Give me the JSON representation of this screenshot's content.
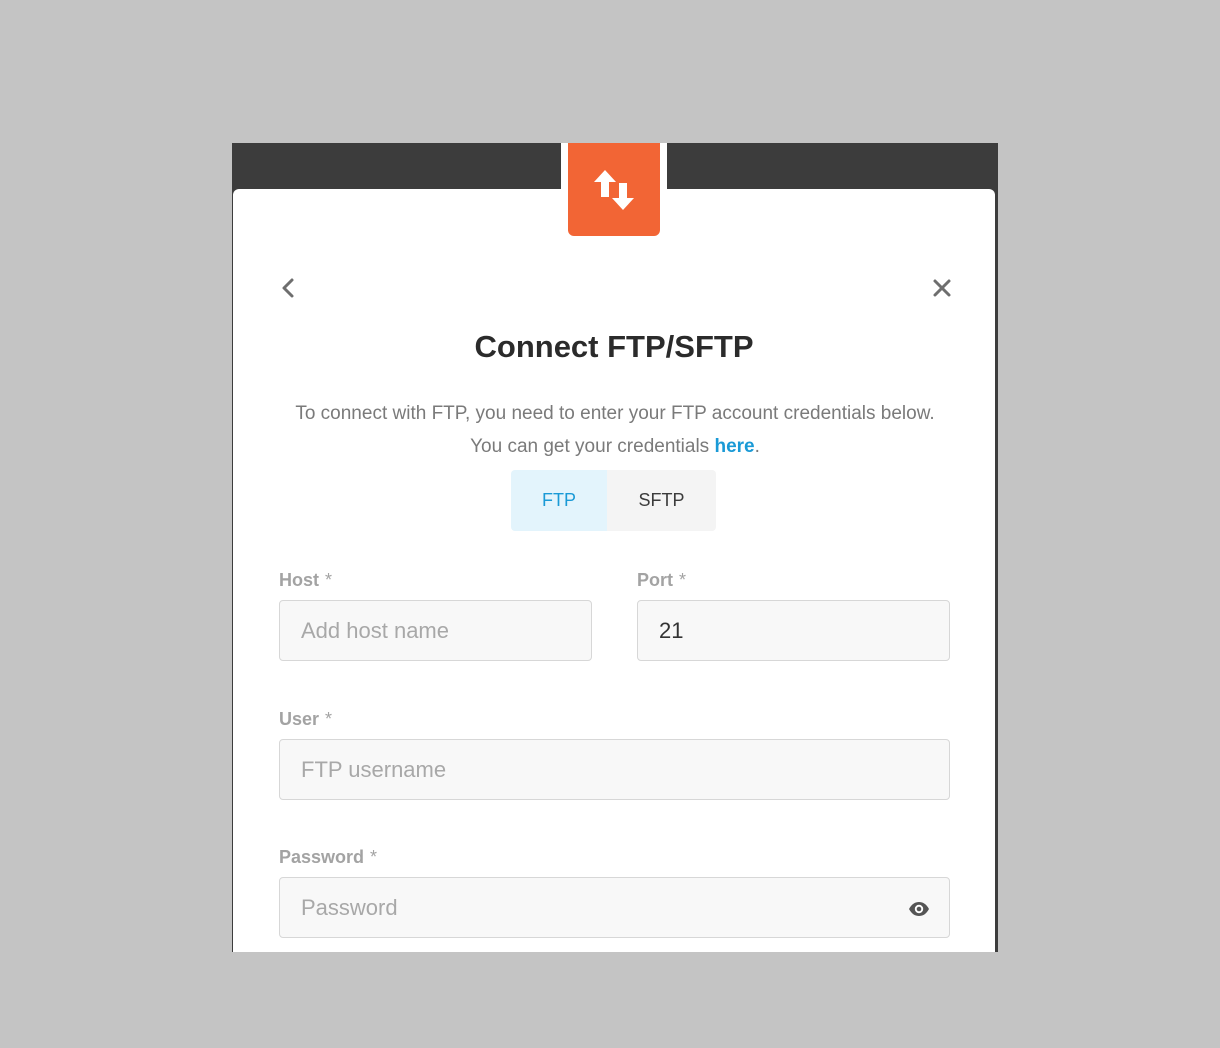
{
  "dialog": {
    "title": "Connect FTP/SFTP",
    "description": "To connect with FTP, you need to enter your FTP account credentials below. You can get your credentials ",
    "link_text": "here",
    "description_end": "."
  },
  "tabs": [
    {
      "label": "FTP",
      "active": true
    },
    {
      "label": "SFTP",
      "active": false
    }
  ],
  "fields": {
    "host": {
      "label": "Host",
      "required": "*",
      "placeholder": "Add host name",
      "value": ""
    },
    "port": {
      "label": "Port",
      "required": "*",
      "placeholder": "",
      "value": "21"
    },
    "user": {
      "label": "User",
      "required": "*",
      "placeholder": "FTP username",
      "value": ""
    },
    "password": {
      "label": "Password",
      "required": "*",
      "placeholder": "Password",
      "value": ""
    }
  },
  "icons": {
    "logo": "transfer-arrows-icon",
    "back": "chevron-left-icon",
    "close": "close-icon",
    "eye": "eye-icon"
  },
  "colors": {
    "brand": "#f26535",
    "accent": "#1a9ad6",
    "tab_active_bg": "#e3f4fc"
  }
}
